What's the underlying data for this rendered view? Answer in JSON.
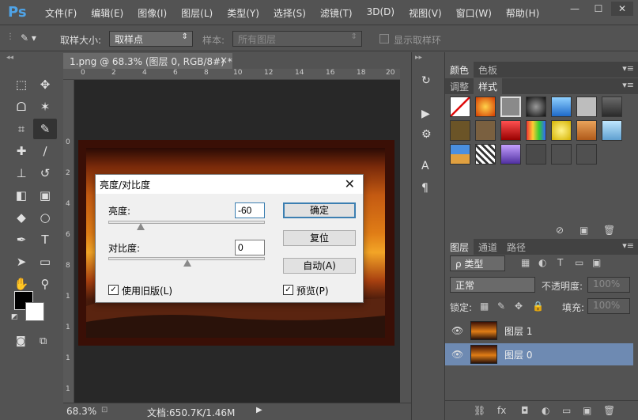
{
  "app": {
    "logo": "Ps"
  },
  "menu": [
    "文件(F)",
    "编辑(E)",
    "图像(I)",
    "图层(L)",
    "类型(Y)",
    "选择(S)",
    "滤镜(T)",
    "3D(D)",
    "视图(V)",
    "窗口(W)",
    "帮助(H)"
  ],
  "window_buttons": {
    "minimize": "—",
    "maximize": "☐",
    "close": "✕"
  },
  "options": {
    "sample_size_label": "取样大小:",
    "sample_size_value": "取样点",
    "sample_label": "样本:",
    "sample_value": "所有图层",
    "show_ring_label": "显示取样环"
  },
  "document": {
    "tab_title": "1.png @ 68.3% (图层 0, RGB/8#) *",
    "tab_close": "×",
    "ruler_h": [
      "0",
      "2",
      "4",
      "6",
      "8",
      "10",
      "12",
      "14",
      "16",
      "18",
      "20"
    ],
    "ruler_v": [
      "0",
      "2",
      "4",
      "6",
      "8",
      "1",
      "1",
      "1",
      "1",
      "1"
    ]
  },
  "status": {
    "zoom": "68.3%",
    "doc_info": "文档:650.7K/1.46M"
  },
  "dialog": {
    "title": "亮度/对比度",
    "brightness_label": "亮度:",
    "brightness_value": "-60",
    "contrast_label": "对比度:",
    "contrast_value": "0",
    "ok_label": "确定",
    "reset_label": "复位",
    "auto_label": "自动(A)",
    "legacy_label": "使用旧版(L)",
    "legacy_checked": true,
    "preview_label": "预览(P)",
    "preview_checked": true,
    "brightness_slider_fraction": 0.2,
    "contrast_slider_fraction": 0.5
  },
  "panels": {
    "color_tabs": [
      "颜色",
      "色板"
    ],
    "style_tabs": [
      "调整",
      "样式"
    ],
    "layer_tabs": [
      "图层",
      "通道",
      "路径"
    ],
    "filter_type": "ρ 类型",
    "blend_mode": "正常",
    "opacity_label": "不透明度:",
    "opacity_value": "100%",
    "lock_label": "锁定:",
    "fill_label": "填充:",
    "fill_value": "100%",
    "layers": [
      {
        "name": "图层 1",
        "selected": false
      },
      {
        "name": "图层 0",
        "selected": true
      }
    ]
  },
  "colors": {
    "selected_layer_bg": "#6e8ab2",
    "accent": "#3c7fb1"
  }
}
